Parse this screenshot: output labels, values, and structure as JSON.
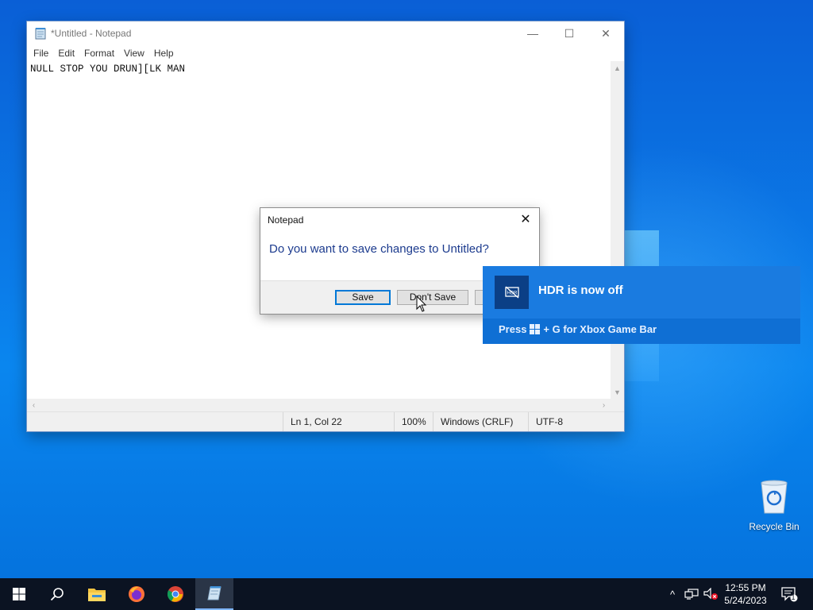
{
  "notepad": {
    "title": "*Untitled - Notepad",
    "window_controls": {
      "minimize": "—",
      "maximize": "☐",
      "close": "✕"
    },
    "menu": [
      "File",
      "Edit",
      "Format",
      "View",
      "Help"
    ],
    "content": "NULL STOP YOU DRUN][LK MAN",
    "status": {
      "position": "Ln 1, Col 22",
      "zoom": "100%",
      "line_ending": "Windows (CRLF)",
      "encoding": "UTF-8"
    }
  },
  "dialog": {
    "title": "Notepad",
    "close": "✕",
    "message": "Do you want to save changes to Untitled?",
    "buttons": {
      "save": "Save",
      "dont_save": "Don't Save",
      "cancel": ""
    }
  },
  "toast": {
    "title": "HDR is now off",
    "press": "Press",
    "shortcut": "+ G for Xbox Game Bar"
  },
  "desktop": {
    "recycle_bin_label": "Recycle Bin"
  },
  "taskbar": {
    "time": "12:55 PM",
    "date": "5/24/2023",
    "notification_count": "1",
    "tray_chevron": "^"
  }
}
